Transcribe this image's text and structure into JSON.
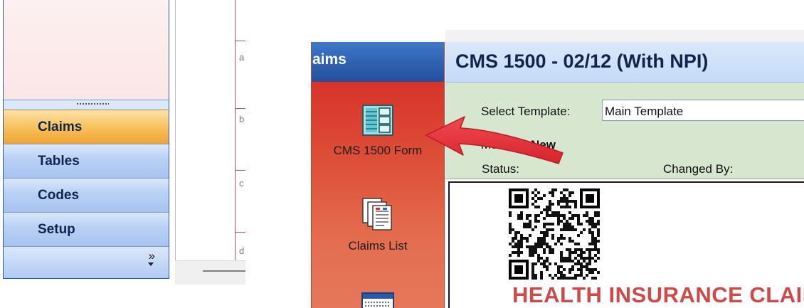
{
  "left_panel": {
    "nav_items": [
      {
        "label": "Claims",
        "active": true
      },
      {
        "label": "Tables",
        "active": false
      },
      {
        "label": "Codes",
        "active": false
      },
      {
        "label": "Setup",
        "active": false
      }
    ],
    "more_glyph": "»",
    "grid_letters": [
      "a",
      "b",
      "c",
      "d"
    ]
  },
  "right_panel": {
    "header": "aims",
    "tools": [
      {
        "label": "CMS 1500 Form",
        "icon": "form-grid-icon"
      },
      {
        "label": "Claims List",
        "icon": "documents-stack-icon"
      },
      {
        "label": "",
        "icon": "data-grid-icon"
      }
    ],
    "doc": {
      "title": "CMS 1500 - 02/12  (With NPI)",
      "template_label": "Select Template:",
      "template_value": "Main Template",
      "mode_label": "Mode:",
      "mode_value": "New",
      "status_label": "Status:",
      "changed_by_label": "Changed By:",
      "form_heading": "HEALTH INSURANCE CLAIM FORM"
    }
  },
  "colors": {
    "accent_arrow": "#e8323c",
    "nav_active": "#f5b24a",
    "nav_inactive": "#bcd3f4",
    "claims_panel": "#dd4a36"
  }
}
